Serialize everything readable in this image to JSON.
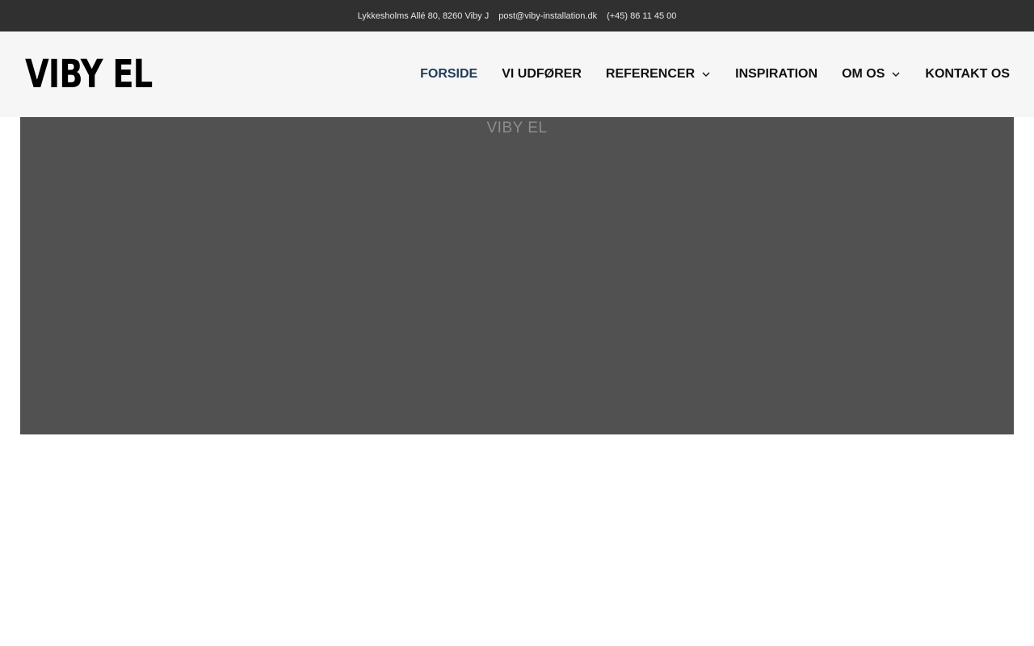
{
  "topbar": {
    "address": "Lykkesholms Allé 80, 8260 Viby J",
    "email": "post@viby-installation.dk",
    "phone": "(+45) 86 11 45 00"
  },
  "header": {
    "logo_text": "VIBY EL"
  },
  "nav": {
    "items": [
      {
        "label": "FORSIDE"
      },
      {
        "label": "VI UDFØRER"
      },
      {
        "label": "REFERENCER"
      },
      {
        "label": "INSPIRATION"
      },
      {
        "label": "OM OS"
      },
      {
        "label": "KONTAKT OS"
      }
    ]
  },
  "hero": {
    "title": "VIBY EL"
  },
  "colors": {
    "topbar_bg": "#303030",
    "header_bg": "#f6f6f6",
    "active_nav": "#1f3a5a",
    "hero_bg": "#515151"
  }
}
